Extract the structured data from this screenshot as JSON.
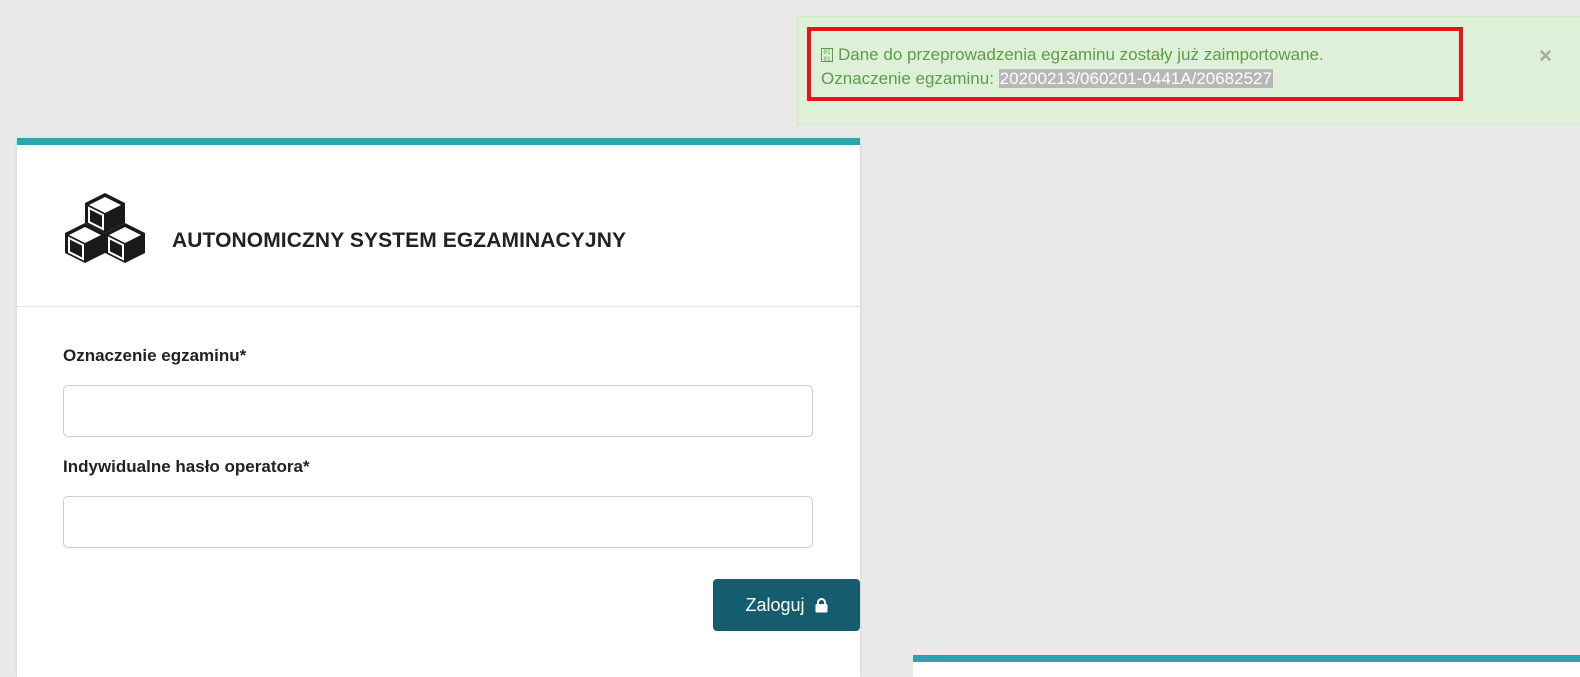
{
  "alert": {
    "icon_glyph": "01\n01",
    "icon": "binary-icon",
    "message": "Dane do przeprowadzenia egzaminu zostały już zaimportowane.",
    "exam_code_label": "Oznaczenie egzaminu:",
    "exam_code_value": "20200213/060201-0441A/20682527",
    "close_label": "×"
  },
  "header": {
    "logo_icon": "cubes-icon",
    "title": "AUTONOMICZNY SYSTEM EGZAMINACYJNY"
  },
  "form": {
    "exam_id_label": "Oznaczenie egzaminu*",
    "exam_id_value": "",
    "password_label": "Indywidualne hasło operatora*",
    "password_value": "",
    "login_label": "Zaloguj",
    "login_icon": "lock-icon"
  },
  "colors": {
    "accent": "#2da3ad",
    "button": "#145c6e",
    "alert_bg": "#dff0d8",
    "alert_text": "#5a9e47",
    "highlight_border": "#e8141c",
    "background": "#e9e9e7"
  }
}
